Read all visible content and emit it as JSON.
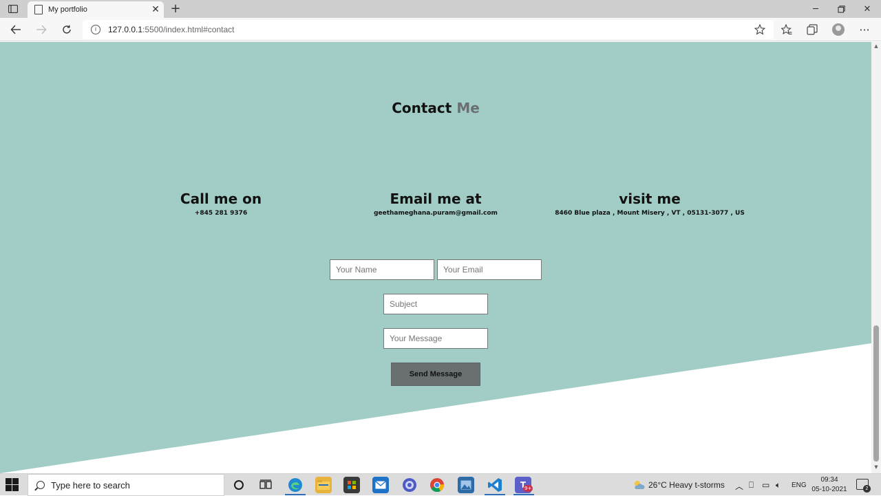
{
  "browser": {
    "tab_title": "My portfolio",
    "url_host": "127.0.0.1",
    "url_path": ":5500/index.html#contact"
  },
  "contact": {
    "heading_main": "Contact",
    "heading_accent": "Me",
    "columns": [
      {
        "title": "Call me on",
        "detail": "+845 281 9376"
      },
      {
        "title": "Email me at",
        "detail": "geethameghana.puram@gmail.com"
      },
      {
        "title": "visit me",
        "detail": "8460 Blue plaza , Mount Misery , VT , 05131-3077 , US"
      }
    ],
    "form": {
      "name_placeholder": "Your Name",
      "email_placeholder": "Your Email",
      "subject_placeholder": "Subject",
      "message_placeholder": "Your Message",
      "send_label": "Send Message"
    },
    "colors": {
      "background": "#a1cdc6",
      "accent": "#6a7072",
      "button": "#6a7072"
    }
  },
  "taskbar": {
    "search_placeholder": "Type here to search",
    "weather": "26°C  Heavy t-storms",
    "language": "ENG",
    "time": "09:34",
    "date": "05-10-2021",
    "teams_badge": "9+",
    "notification_count": "2",
    "apps": [
      "cortana-icon",
      "task-view-icon",
      "edge-icon",
      "file-explorer-icon",
      "store-icon",
      "mail-icon",
      "app-icon",
      "chrome-icon",
      "photos-icon",
      "vscode-icon",
      "teams-icon"
    ]
  }
}
